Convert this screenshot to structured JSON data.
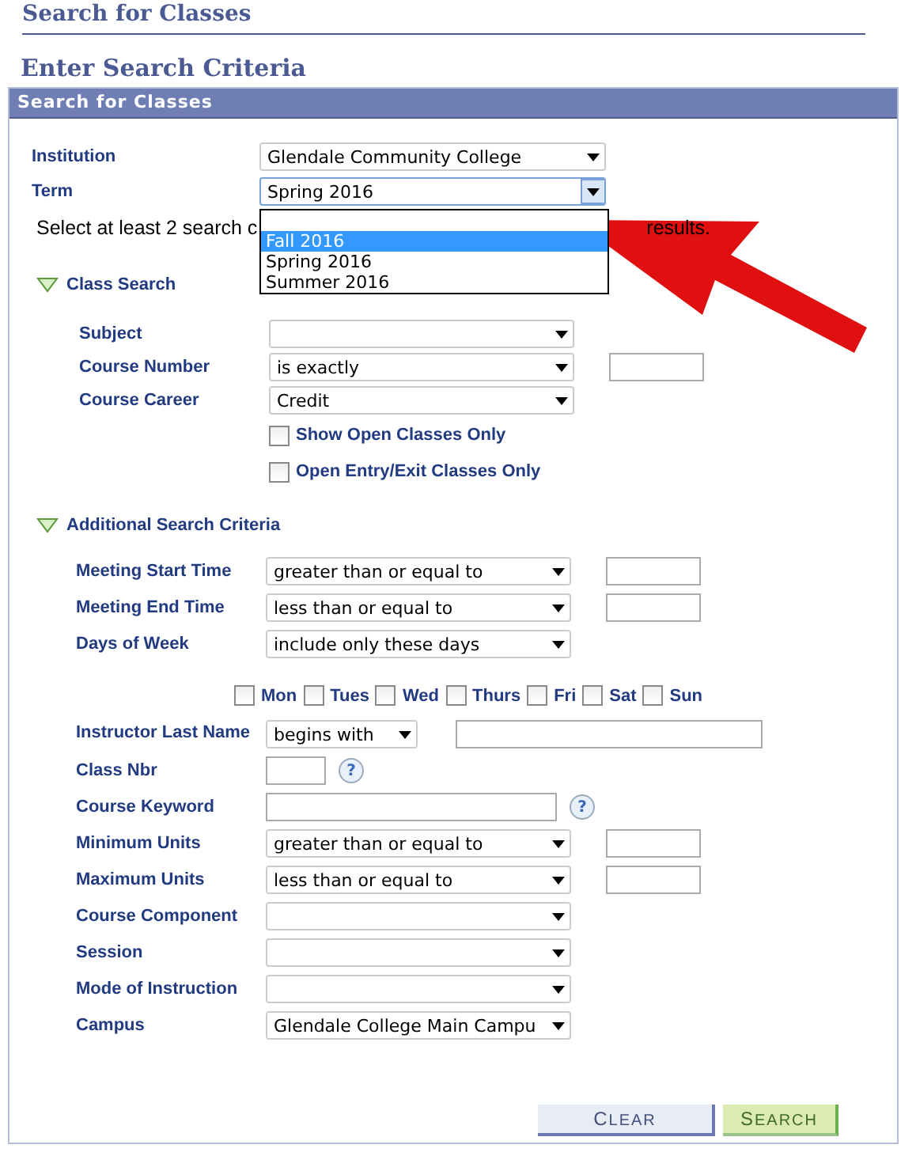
{
  "page_title": "Search for Classes",
  "section_title": "Enter Search Criteria",
  "panel_title": "Search for Classes",
  "top_fields": [
    {
      "label": "Institution",
      "value": "Glendale Community College",
      "open": false
    },
    {
      "label": "Term",
      "value": "Spring 2016",
      "open": true
    }
  ],
  "term_options": [
    {
      "label": "Fall 2016",
      "selected": true
    },
    {
      "label": "Spring 2016",
      "selected": false
    },
    {
      "label": "Summer 2016",
      "selected": false
    }
  ],
  "instruction": {
    "before": "Select at least 2 search c",
    "after": "results."
  },
  "sections": [
    {
      "title": "Class Search",
      "expanded": true,
      "rows": [
        {
          "kind": "select",
          "label": "Subject",
          "with_field": false
        },
        {
          "kind": "select",
          "label": "Course Number",
          "value": "is exactly",
          "with_field": true
        },
        {
          "kind": "select",
          "label": "Course Career",
          "value": "Credit",
          "with_field": false
        },
        {
          "kind": "checkbox",
          "label": "Show Open Classes Only",
          "checked": false
        },
        {
          "kind": "checkbox",
          "label": "Open Entry/Exit Classes Only",
          "checked": false
        }
      ]
    },
    {
      "title": "Additional Search Criteria",
      "expanded": true,
      "rows": [
        {
          "kind": "select",
          "label": "Meeting Start Time",
          "value": "greater than or equal to",
          "with_field": true
        },
        {
          "kind": "select",
          "label": "Meeting End Time",
          "value": "less than or equal to",
          "with_field": true
        },
        {
          "kind": "select",
          "label": "Days of Week",
          "value": "include only these days",
          "with_field": false
        },
        {
          "kind": "days",
          "days": [
            {
              "label": "Mon",
              "checked": false
            },
            {
              "label": "Tues",
              "checked": false
            },
            {
              "label": "Wed",
              "checked": false
            },
            {
              "label": "Thurs",
              "checked": false
            },
            {
              "label": "Fri",
              "checked": false
            },
            {
              "label": "Sat",
              "checked": false
            },
            {
              "label": "Sun",
              "checked": false
            }
          ]
        },
        {
          "kind": "name_select",
          "label": "Instructor Last Name",
          "value": "begins with"
        },
        {
          "kind": "short_field",
          "label": "Class Nbr",
          "help": "?"
        },
        {
          "kind": "long_field",
          "label": "Course Keyword",
          "help": "?"
        },
        {
          "kind": "select",
          "label": "Minimum Units",
          "value": "greater than or equal to",
          "with_field": true
        },
        {
          "kind": "select",
          "label": "Maximum Units",
          "value": "less than or equal to",
          "with_field": true
        },
        {
          "kind": "select",
          "label": "Course Component",
          "with_field": false
        },
        {
          "kind": "select",
          "label": "Session",
          "with_field": false
        },
        {
          "kind": "select",
          "label": "Mode of Instruction",
          "with_field": false
        },
        {
          "kind": "select",
          "label": "Campus",
          "value": "Glendale College Main Campu",
          "with_field": false
        }
      ]
    }
  ],
  "buttons": [
    {
      "label": "CLEAR",
      "kind": "secondary"
    },
    {
      "label": "SEARCH",
      "kind": "primary"
    }
  ]
}
